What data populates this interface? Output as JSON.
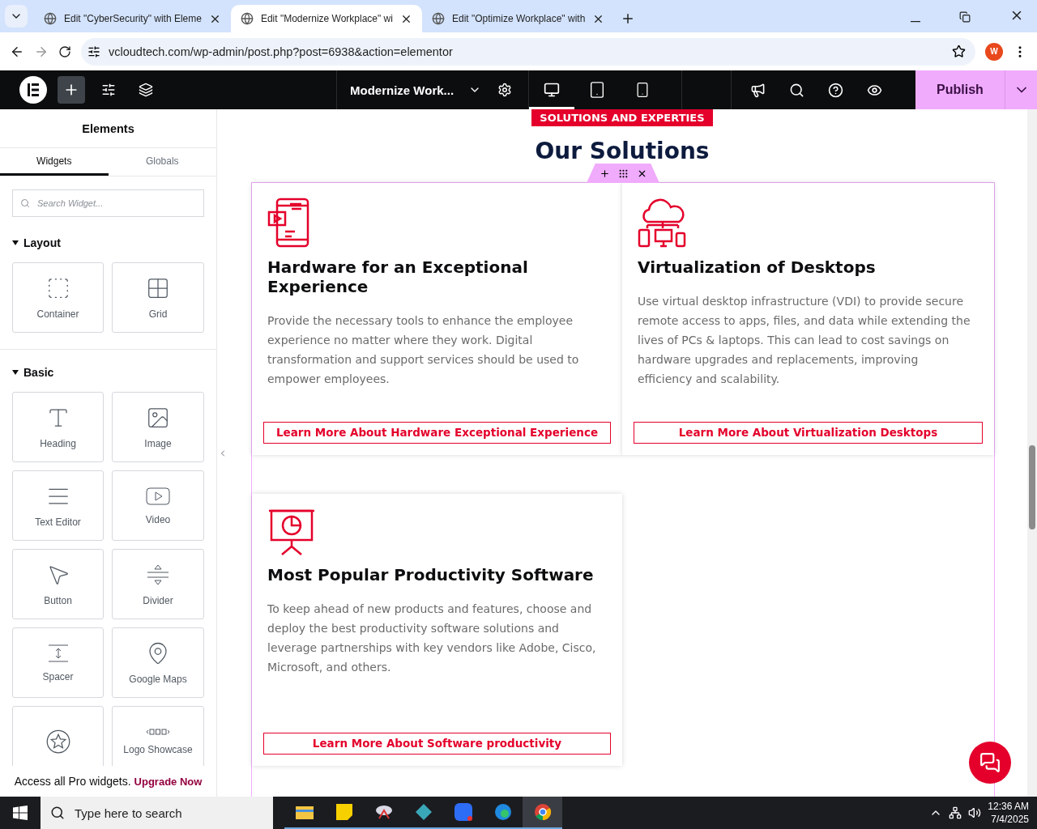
{
  "browser": {
    "tabs": [
      {
        "title": "Edit \"CyberSecurity\" with Eleme",
        "selected": false
      },
      {
        "title": "Edit \"Modernize Workplace\" wi",
        "selected": true
      },
      {
        "title": "Edit \"Optimize Workplace\" with",
        "selected": false
      }
    ],
    "url": "vcloudtech.com/wp-admin/post.php?post=6938&action=elementor",
    "profile_initial": "W"
  },
  "toolbar": {
    "page_title": "Modernize Work...",
    "devices": [
      {
        "kind": "desktop",
        "selected": true
      },
      {
        "kind": "tablet",
        "selected": false
      },
      {
        "kind": "mobile",
        "selected": false
      }
    ],
    "publish": "Publish"
  },
  "panel": {
    "title": "Elements",
    "tabs": [
      {
        "label": "Widgets",
        "selected": true
      },
      {
        "label": "Globals",
        "selected": false
      }
    ],
    "search": {
      "placeholder": "Search Widget..."
    },
    "sections": [
      {
        "title": "Layout",
        "expanded": true,
        "widgets": [
          {
            "kind": "container",
            "label": "Container"
          },
          {
            "kind": "grid",
            "label": "Grid"
          }
        ]
      },
      {
        "title": "Basic",
        "expanded": true,
        "widgets": [
          {
            "kind": "heading",
            "label": "Heading"
          },
          {
            "kind": "image",
            "label": "Image"
          },
          {
            "kind": "text",
            "label": "Text Editor"
          },
          {
            "kind": "video",
            "label": "Video"
          },
          {
            "kind": "button",
            "label": "Button"
          },
          {
            "kind": "divider",
            "label": "Divider"
          },
          {
            "kind": "spacer",
            "label": "Spacer"
          },
          {
            "kind": "map",
            "label": "Google Maps"
          },
          {
            "kind": "star"
          },
          {
            "kind": "logos",
            "label": "Logo Showcase"
          }
        ]
      }
    ],
    "promo": {
      "text": "Access all Pro widgets.",
      "link": "Upgrade Now"
    }
  },
  "canvas": {
    "badge": "SOLUTIONS AND EXPERTIES",
    "heading": "Our Solutions",
    "cards": [
      {
        "kind": "tablet",
        "title": "Hardware for an Exceptional Experience",
        "body": "Provide the necessary tools to enhance the employee experience no matter where they work. Digital transformation and support services should be used to empower employees.",
        "link": "Learn More About Hardware Exceptional Experience"
      },
      {
        "kind": "cloud",
        "title": "Virtualization of Desktops",
        "body": "Use virtual desktop infrastructure (VDI) to provide secure remote access to apps, files, and data while extending the lives of PCs & laptops. This can lead to cost savings on hardware upgrades and replacements, improving efficiency and scalability.",
        "link": "Learn More About Virtualization Desktops"
      },
      {
        "kind": "presentation",
        "title": "Most Popular Productivity Software",
        "body": "To keep ahead of new products and features, choose and deploy the best productivity software solutions and leverage partnerships with key vendors like Adobe, Cisco, Microsoft, and others.",
        "link": "Learn More About Software productivity"
      }
    ]
  },
  "taskbar": {
    "search_placeholder": "Type here to search",
    "time": "12:36 AM",
    "date": "7/4/2025"
  }
}
